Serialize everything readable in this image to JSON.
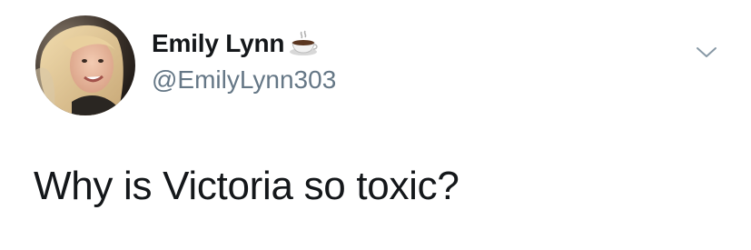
{
  "tweet": {
    "display_name": "Emily Lynn",
    "name_emoji": "hot-beverage-emoji",
    "handle": "@EmilyLynn303",
    "text": "Why is Victoria so toxic?"
  },
  "icons": {
    "menu": "chevron-down-icon"
  },
  "colors": {
    "text_primary": "#14171a",
    "text_secondary": "#657786",
    "chevron": "#8899a6",
    "background": "#ffffff"
  }
}
